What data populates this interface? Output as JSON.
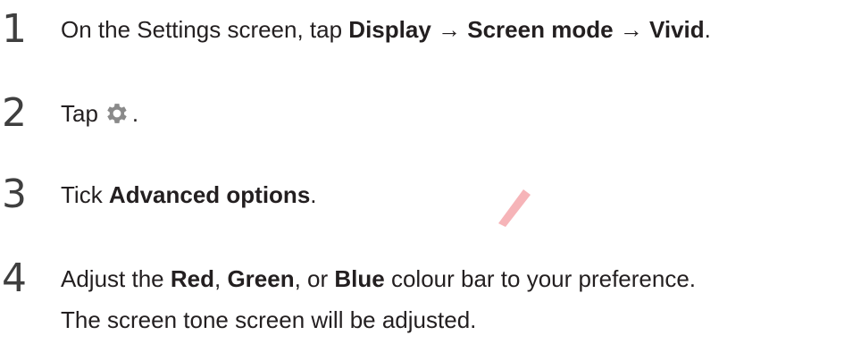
{
  "steps": [
    {
      "number": "1",
      "parts": [
        "On the Settings screen, tap ",
        "Display",
        " → ",
        "Screen mode",
        " → ",
        "Vivid",
        "."
      ]
    },
    {
      "number": "2",
      "before": "Tap",
      "icon": "gear-icon",
      "after": "."
    },
    {
      "number": "3",
      "parts": [
        "Tick ",
        "Advanced options",
        "."
      ]
    },
    {
      "number": "4",
      "parts": [
        "Adjust the ",
        "Red",
        ", ",
        "Green",
        ", or ",
        "Blue",
        " colour bar to your preference."
      ],
      "note": "The screen tone screen will be adjusted."
    }
  ],
  "colors": {
    "text": "#231f20",
    "number": "#3f3f3f",
    "icon": "#8a8a8a",
    "watermark": "#f4a7ab"
  }
}
